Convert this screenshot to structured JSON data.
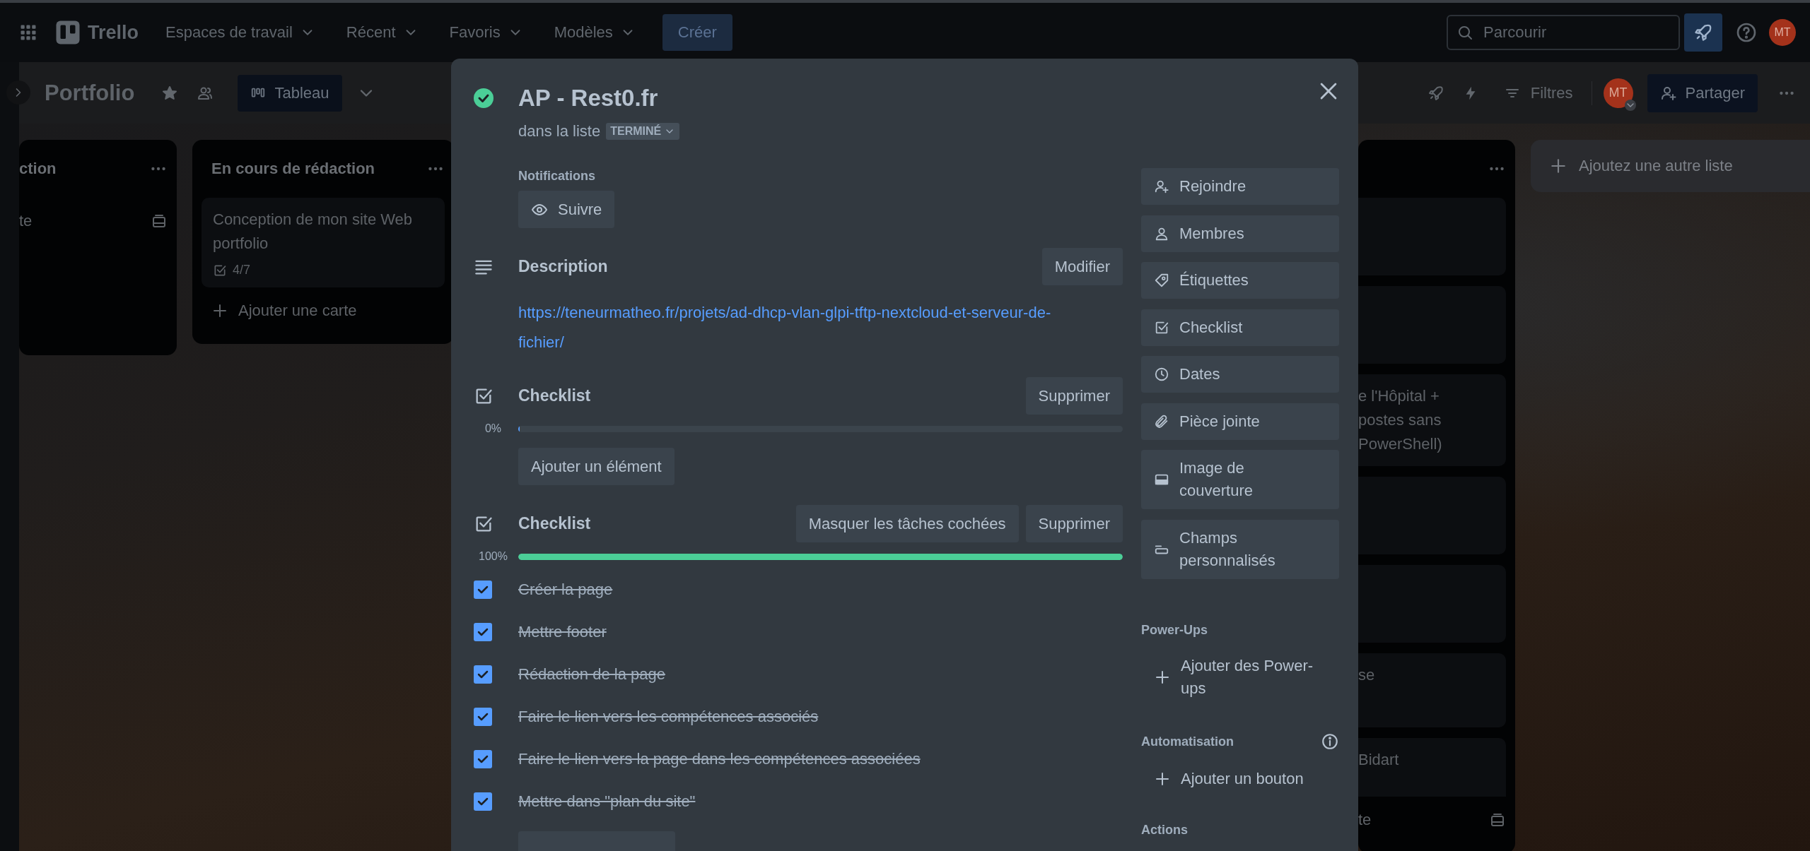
{
  "top_bar": {
    "logo": "Trello",
    "menus": [
      "Espaces de travail",
      "Récent",
      "Favoris",
      "Modèles"
    ],
    "create_button": "Créer",
    "search": {
      "placeholder": "Parcourir"
    },
    "avatar": "MT"
  },
  "board_header": {
    "title": "Portfolio",
    "view_button": "Tableau",
    "filter_button": "Filtres",
    "avatar": "MT",
    "share_button": "Partager"
  },
  "lists": [
    {
      "title": "ction",
      "footer": "te"
    },
    {
      "title": "En cours de rédaction",
      "cards": [
        {
          "kind": "text",
          "lines": [
            "Conception de mon site Web portfolio"
          ],
          "checklist": "4/7"
        }
      ],
      "footer": "Ajouter une carte"
    },
    {
      "cards": [
        {
          "kind": "blank"
        },
        {
          "kind": "blank"
        },
        {
          "kind": "text",
          "lines": [
            "e l'Hôpital +",
            "postes sans",
            "PowerShell)"
          ]
        },
        {
          "kind": "blank"
        },
        {
          "kind": "blank"
        },
        {
          "kind": "text",
          "lines": [
            "se"
          ]
        },
        {
          "kind": "text",
          "lines": [
            "Bidart"
          ]
        }
      ],
      "footer": "te"
    }
  ],
  "add_list": "Ajoutez une autre liste",
  "card_modal": {
    "title": "AP - Rest0.fr",
    "completed": true,
    "list_prefix": "dans la liste",
    "list_name": "TERMINÉ",
    "notifications": {
      "label": "Notifications",
      "button": "Suivre"
    },
    "description": {
      "heading": "Description",
      "button": "Modifier",
      "link": "https://teneurmatheo.fr/projets/ad-dhcp-vlan-glpi-tftp-nextcloud-et-serveur-de-fichier/"
    },
    "checklists": [
      {
        "title": "Checklist",
        "buttons": [
          "Supprimer"
        ],
        "percent": "0%",
        "level": 0,
        "add_button": "Ajouter un élément"
      },
      {
        "title": "Checklist",
        "buttons": [
          "Masquer les tâches cochées",
          "Supprimer"
        ],
        "percent": "100%",
        "level": 1,
        "items": [
          {
            "text": "Créer la page",
            "checked": true
          },
          {
            "text": "Mettre footer",
            "checked": true
          },
          {
            "text": "Rédaction de la page",
            "checked": true
          },
          {
            "text": "Faire le lien vers les compétences associés",
            "checked": true
          },
          {
            "text": "Faire le lien vers la page dans les compétences associées",
            "checked": true
          },
          {
            "text": "Mettre dans \"plan du site\"",
            "checked": true
          }
        ]
      }
    ],
    "sidebar": {
      "buttons": [
        "Rejoindre",
        "Membres",
        "Étiquettes",
        "Checklist",
        "Dates",
        "Pièce jointe",
        "Image de couverture",
        "Champs personnalisés"
      ],
      "power_ups": {
        "heading": "Power-Ups",
        "button": "Ajouter des Power-ups"
      },
      "automation": {
        "heading": "Automatisation",
        "button": "Ajouter un bouton"
      },
      "actions_heading": "Actions"
    }
  }
}
